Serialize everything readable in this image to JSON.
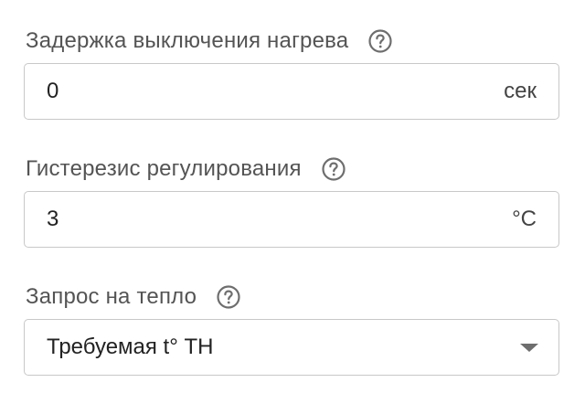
{
  "fields": [
    {
      "label": "Задержка выключения нагрева",
      "value": "0",
      "unit": "сек",
      "help_icon": "help-circle-icon"
    },
    {
      "label": "Гистерезис регулирования",
      "value": "3",
      "unit": "°C",
      "help_icon": "help-circle-icon"
    },
    {
      "label": "Запрос на тепло",
      "selected": "Требуемая t° ТН",
      "help_icon": "help-circle-icon",
      "dropdown_icon": "chevron-down-icon"
    }
  ],
  "colors": {
    "label": "#545454",
    "border": "#c8c8c8",
    "icon": "#6e6e6e",
    "text": "#222222"
  }
}
